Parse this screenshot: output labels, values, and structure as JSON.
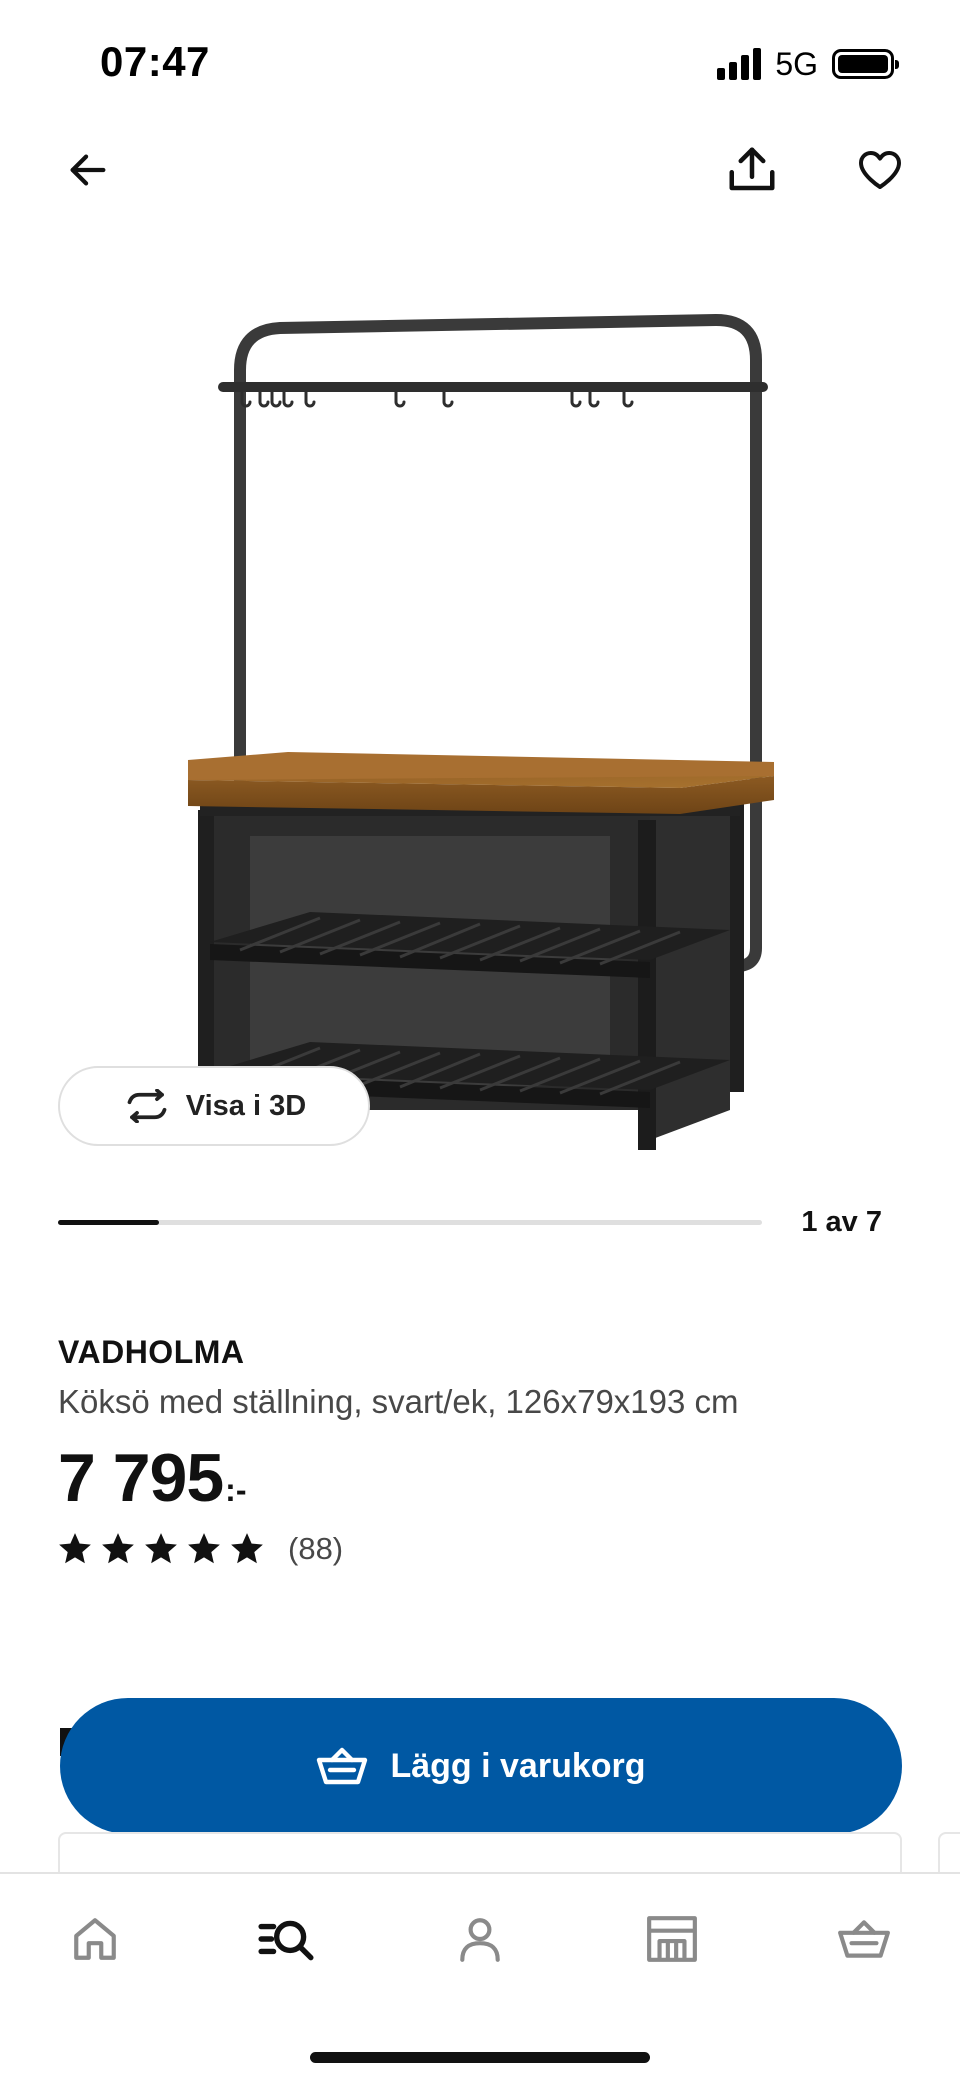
{
  "status_bar": {
    "time": "07:47",
    "network": "5G"
  },
  "header": {
    "back_icon": "arrow-left-icon",
    "share_icon": "share-icon",
    "favorite_icon": "heart-outline-icon"
  },
  "gallery": {
    "image_alt": "VADHOLMA kitchen island with rack",
    "view3d_label": "Visa i 3D",
    "current_image": 1,
    "total_images": 7,
    "counter_text": "1 av 7"
  },
  "product": {
    "name": "VADHOLMA",
    "description": "Köksö med ställning, svart/ek, 126x79x193 cm",
    "price_integer": "7 795",
    "price_suffix": ":-",
    "rating_stars": 5,
    "review_count": "(88)"
  },
  "cart": {
    "add_label": "Lägg i varukorg",
    "icon": "basket-icon",
    "accent_color": "#0058a3"
  },
  "tabbar": {
    "items": [
      {
        "name": "home",
        "icon": "home-icon"
      },
      {
        "name": "search",
        "icon": "search-list-icon",
        "active": true
      },
      {
        "name": "profile",
        "icon": "profile-icon"
      },
      {
        "name": "store",
        "icon": "store-icon"
      },
      {
        "name": "basket",
        "icon": "basket-icon"
      }
    ]
  }
}
